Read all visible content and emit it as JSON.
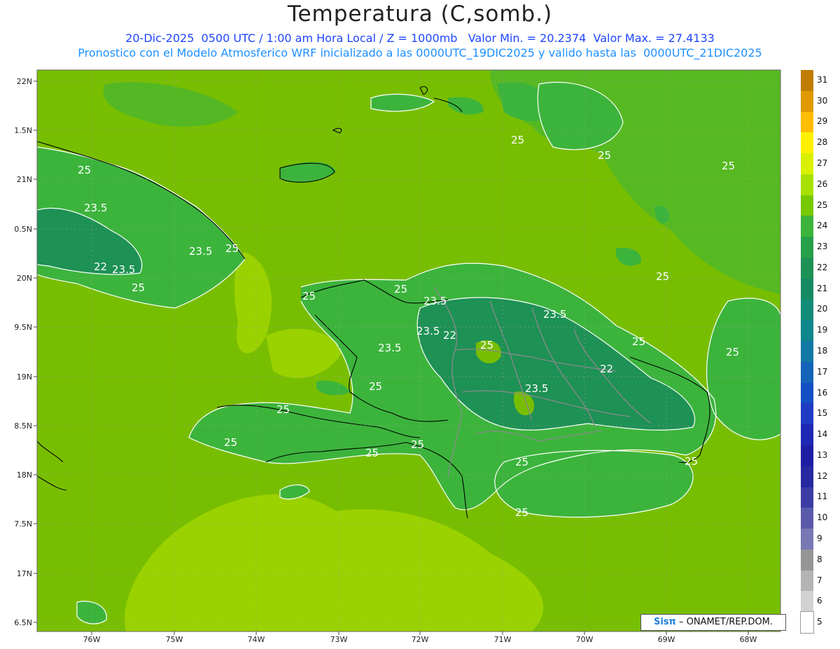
{
  "title": "Temperatura (C,somb.)",
  "subtitle_line1": "20-Dic-2025  0500 UTC / 1:00 am Hora Local / Z = 1000mb   Valor Min. = 20.2374  Valor Max. = 27.4133",
  "subtitle_line2": "Pronostico con el Modelo Atmosferico WRF inicializado a las 0000UTC_19DIC2025 y valido hasta las  0000UTC_21DIC2025",
  "lat_labels": [
    "22N",
    "1.5N",
    "21N",
    "0.5N",
    "20N",
    "9.5N",
    "19N",
    "8.5N",
    "18N",
    "7.5N",
    "17N",
    "6.5N"
  ],
  "lon_labels": [
    "76W",
    "75W",
    "74W",
    "73W",
    "72W",
    "71W",
    "70W",
    "69W",
    "68W"
  ],
  "contour_labels": [
    "25",
    "23.5",
    "23.5",
    "23.5",
    "22",
    "25",
    "25",
    "25",
    "25",
    "23.5",
    "23.5",
    "22",
    "25",
    "23.5",
    "23.5",
    "25",
    "22",
    "25",
    "25",
    "25",
    "25",
    "25",
    "25",
    "23.5",
    "25",
    "25",
    "25",
    "25",
    "25",
    "25",
    "25"
  ],
  "colorbar": {
    "levels": [
      "31",
      "30",
      "29",
      "28",
      "27",
      "26",
      "25",
      "24",
      "23",
      "22",
      "21",
      "20",
      "19",
      "18",
      "17",
      "16",
      "15",
      "14",
      "13",
      "12",
      "11",
      "10",
      "9",
      "8",
      "7",
      "6",
      "5"
    ],
    "colors": [
      "#c07c00",
      "#e09a00",
      "#ffbd00",
      "#fff000",
      "#d9f000",
      "#a8e000",
      "#78c800",
      "#3cb43c",
      "#28a04a",
      "#1e9155",
      "#178a64",
      "#128c78",
      "#10878c",
      "#1478a5",
      "#1464b9",
      "#1450c3",
      "#1e3cc3",
      "#1e28b4",
      "#1e1ea5",
      "#2828a0",
      "#3c3ca5",
      "#5a5aaa",
      "#7878b4",
      "#969696",
      "#b4b4b4",
      "#d2d2d2",
      "#ffffff"
    ]
  },
  "logo": {
    "brand": "Sisπ",
    "text": "– ONAMET/REP.DOM."
  },
  "colors": {
    "ocean": "#78be00",
    "lightgreen": "#9ad200",
    "land": "#3cb43c",
    "dark": "#1e9155",
    "contour": "#ffffff"
  }
}
